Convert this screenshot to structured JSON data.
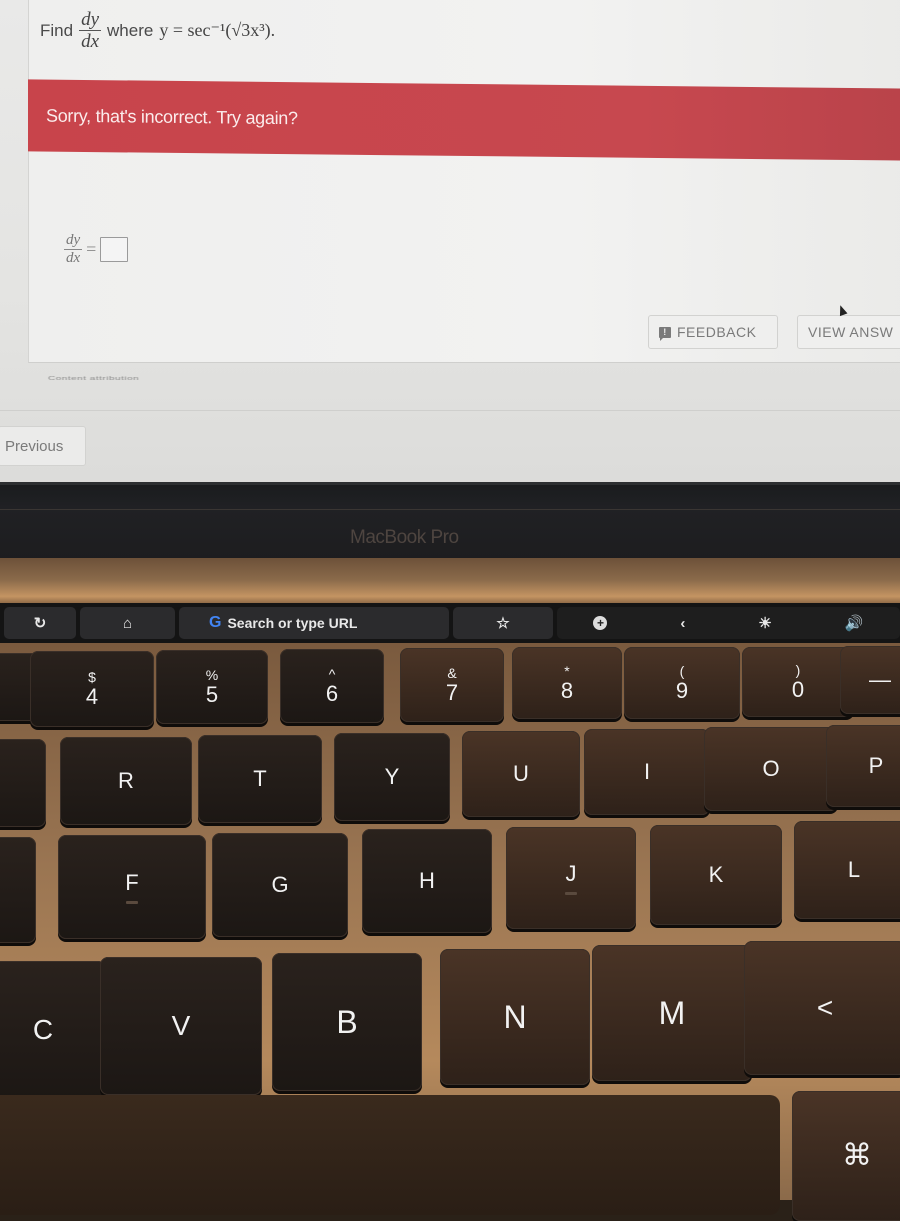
{
  "question": {
    "prefix": "Find",
    "derivative_num": "dy",
    "derivative_den": "dx",
    "middle": "where",
    "equation": "y = sec⁻¹(√3x³)."
  },
  "feedback_banner": {
    "message": "Sorry, that's incorrect. Try again?",
    "color": "#c8444b"
  },
  "answer": {
    "lhs_num": "dy",
    "lhs_den": "dx",
    "equals": "=",
    "value": ""
  },
  "actions": {
    "feedback_label": "FEEDBACK",
    "feedback_icon": "!",
    "view_answer_label": "VIEW ANSW"
  },
  "attribution": "Content attribution",
  "navigation": {
    "previous_label": "Previous"
  },
  "bezel": {
    "brand": "MacBook Pro"
  },
  "touchbar": {
    "reload_icon": "↻",
    "home_icon": "⌂",
    "google_icon": "G",
    "search_placeholder": "Search or type URL",
    "star_icon": "☆",
    "add_icon": "+",
    "collapse_icon": "‹",
    "brightness_icon": "☀",
    "volume_icon": "🔊"
  },
  "keyboard": {
    "number_row": [
      {
        "shift": "$",
        "main": "4"
      },
      {
        "shift": "%",
        "main": "5"
      },
      {
        "shift": "^",
        "main": "6"
      },
      {
        "shift": "&",
        "main": "7"
      },
      {
        "shift": "*",
        "main": "8"
      },
      {
        "shift": "(",
        "main": "9"
      },
      {
        "shift": ")",
        "main": "0"
      },
      {
        "shift": "",
        "main": "—"
      }
    ],
    "top_row": [
      "R",
      "T",
      "Y",
      "U",
      "I",
      "O",
      "P"
    ],
    "home_row": [
      "F",
      "G",
      "H",
      "J",
      "K",
      "L"
    ],
    "bottom_row": [
      "C",
      "V",
      "B",
      "N",
      "M",
      "<"
    ],
    "command_symbol": "⌘"
  }
}
